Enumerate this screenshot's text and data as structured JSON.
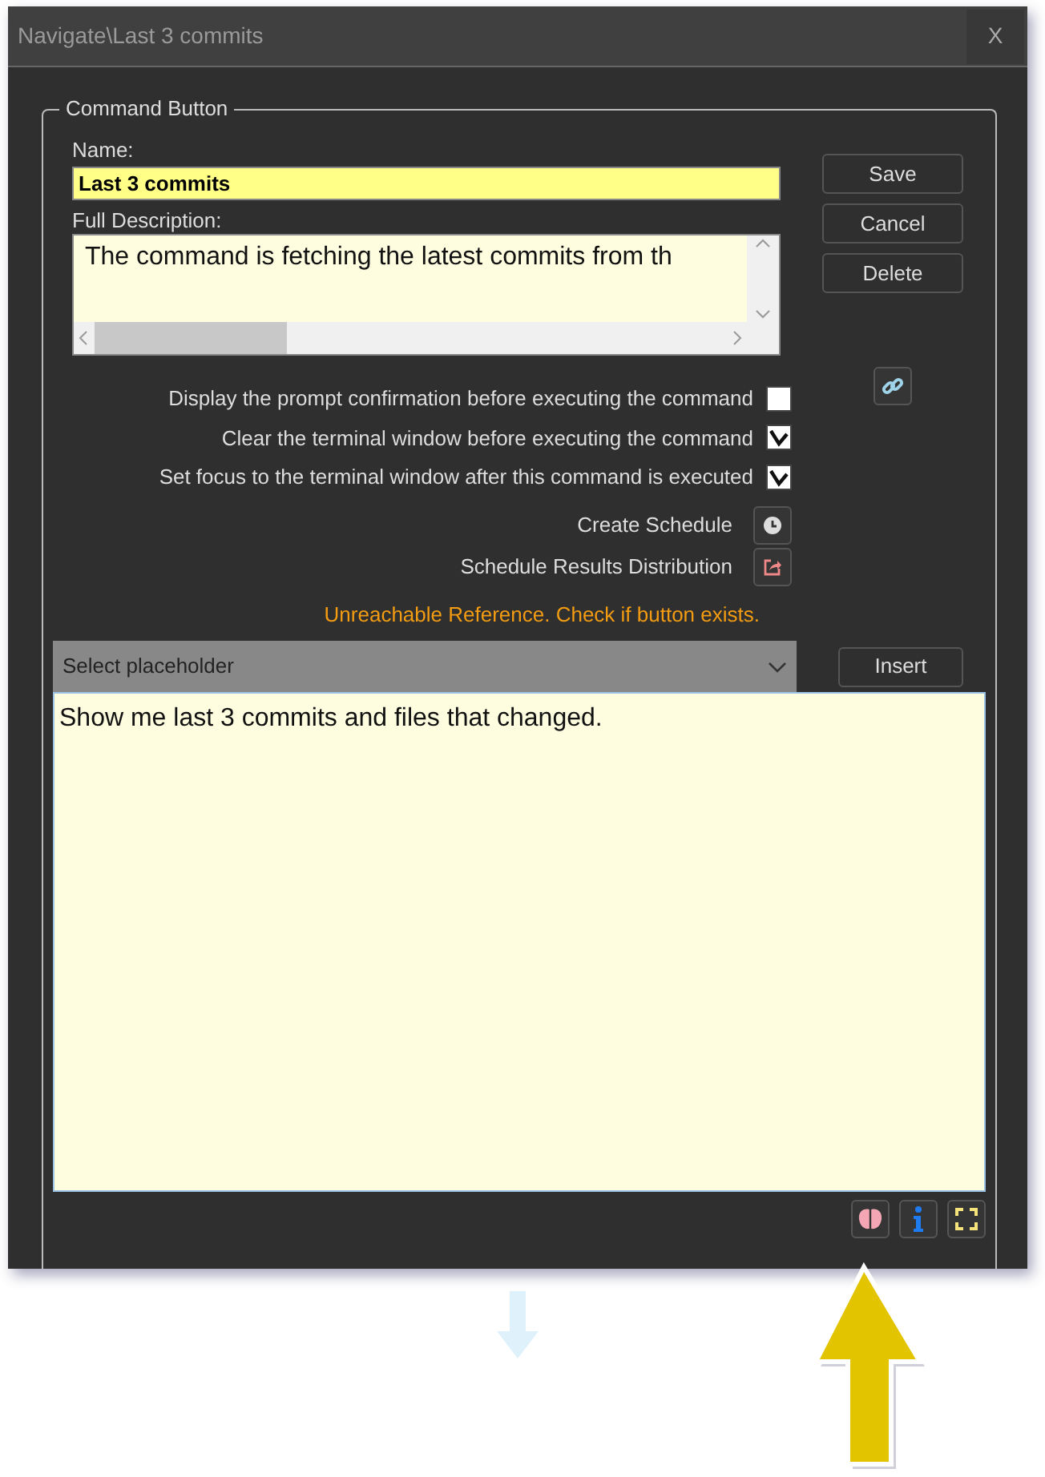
{
  "window": {
    "title": "Navigate\\Last 3 commits",
    "close": "X"
  },
  "group": {
    "legend": "Command Button"
  },
  "name": {
    "label": "Name:",
    "value": "Last 3 commits"
  },
  "description": {
    "label": "Full Description:",
    "value": "The command is fetching the latest commits from th"
  },
  "buttons": [
    "Save",
    "Cancel",
    "Delete"
  ],
  "options": [
    {
      "label": "Display the prompt confirmation before executing the command",
      "checked": false
    },
    {
      "label": "Clear the terminal window before executing the command",
      "checked": true
    },
    {
      "label": "Set focus to the terminal window after this command is executed",
      "checked": true
    }
  ],
  "actions": [
    {
      "label": "Create Schedule",
      "kind": "clock"
    },
    {
      "label": "Schedule Results Distribution",
      "kind": "share"
    }
  ],
  "warning": "Unreachable Reference. Check if button exists.",
  "placeholder_select": {
    "placeholder": "Select placeholder"
  },
  "insert_button": "Insert",
  "prompt": {
    "value": "Show me last 3 commits and files that changed."
  },
  "toolbar": [
    {
      "kind": "brain"
    },
    {
      "kind": "info"
    },
    {
      "kind": "expand"
    }
  ]
}
